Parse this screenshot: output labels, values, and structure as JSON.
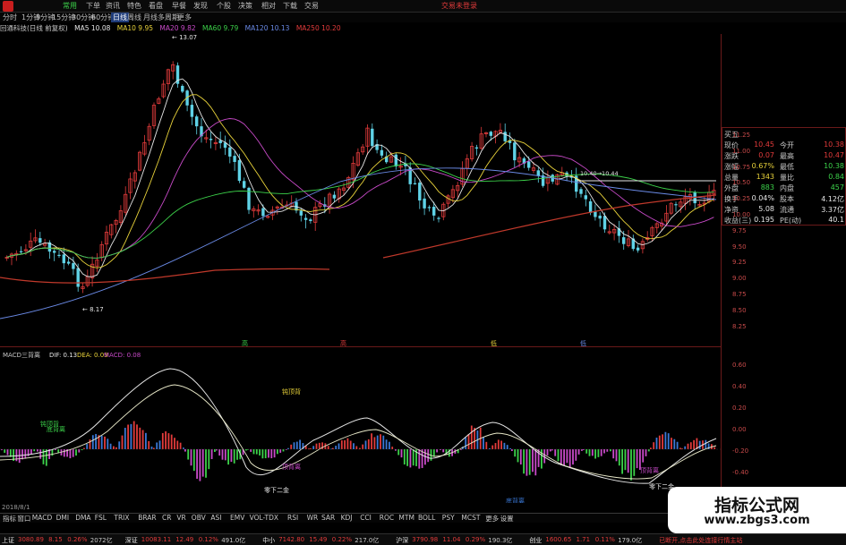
{
  "menubar": {
    "items": [
      "常用",
      "下单",
      "资讯",
      "特色",
      "看盘",
      "早餐",
      "发现",
      "个股",
      "决策",
      "相对",
      "下载",
      "交易"
    ],
    "notice": "交易未登录"
  },
  "periodbar": {
    "items": [
      "分时",
      "1分钟",
      "5分钟",
      "15分钟",
      "30分钟",
      "60分钟",
      "日线",
      "周线",
      "月线",
      "多周期",
      "更多"
    ]
  },
  "maline": {
    "stock": "回通科技(日线 前复权)",
    "ma5": "MA5 10.08",
    "ma10": "MA10 9.95",
    "ma20": "MA20 9.82",
    "ma60": "MA60 9.79",
    "ma120": "MA120 10.13",
    "ma250": "MA250 10.20"
  },
  "main_chart": {
    "price_axis": [
      "11.25",
      "11.00",
      "10.75",
      "10.50",
      "10.25",
      "10.00",
      "9.75",
      "9.50",
      "9.25",
      "9.00",
      "8.75",
      "8.50",
      "8.25"
    ],
    "high_label": "13.07",
    "low_label": "8.17",
    "mid_label": "10.40→10.44",
    "signal_labels": [
      "高",
      "高",
      "低",
      "低"
    ]
  },
  "macd": {
    "title": "MACD三背离",
    "dif": "DIF: 0.13",
    "dea": "DEA: 0.09",
    "macd": "MACD: 0.08",
    "axis": [
      "0.60",
      "0.40",
      "0.20",
      "0.00",
      "-0.20",
      "-0.40"
    ],
    "annotations": [
      "钝顶背",
      "顶背离",
      "底背离",
      "零下二金",
      "底背离",
      "零下二金",
      "顶背离",
      "钝顶背"
    ]
  },
  "quote_panel": {
    "rows": [
      {
        "k": "买五",
        "v": "",
        "k2": "",
        "v2": ""
      },
      {
        "k": "现价",
        "v": "10.45",
        "k2": "今开",
        "v2": "10.38"
      },
      {
        "k": "涨跌",
        "v": "0.07",
        "k2": "最高",
        "v2": "10.47"
      },
      {
        "k": "涨幅",
        "v": "0.67%",
        "k2": "最低",
        "v2": "10.38"
      },
      {
        "k": "总量",
        "v": "1343",
        "k2": "量比",
        "v2": "0.84"
      },
      {
        "k": "外盘",
        "v": "883",
        "k2": "内盘",
        "v2": "457"
      },
      {
        "k": "换手",
        "v": "0.04%",
        "k2": "股本",
        "v2": "4.12亿"
      },
      {
        "k": "净资",
        "v": "5.08",
        "k2": "流通",
        "v2": "3.37亿"
      },
      {
        "k": "收益(三)",
        "v": "0.195",
        "k2": "PE(动)",
        "v2": "40.1"
      }
    ]
  },
  "datestrip": {
    "label": "2018/8/1"
  },
  "tabbar": {
    "items": [
      "指标",
      "窗口",
      "MACD",
      "DMI",
      "DMA",
      "FSL",
      "TRIX",
      "BRAR",
      "CR",
      "VR",
      "OBV",
      "ASI",
      "EMV",
      "VOL-TDX",
      "RSI",
      "WR",
      "SAR",
      "KDJ",
      "CCI",
      "ROC",
      "MTM",
      "BOLL",
      "PSY",
      "MCST",
      "更多",
      "设置"
    ]
  },
  "statusbar": {
    "items": [
      {
        "t": "上证",
        "c": "#e6e6e6"
      },
      {
        "t": "3080.89",
        "c": "#e23b3b"
      },
      {
        "t": "8.15",
        "c": "#e23b3b"
      },
      {
        "t": "0.26%",
        "c": "#e23b3b"
      },
      {
        "t": "2072亿",
        "c": "#c8c8c8"
      },
      {
        "t": "深证",
        "c": "#e6e6e6"
      },
      {
        "t": "10083.11",
        "c": "#e23b3b"
      },
      {
        "t": "12.49",
        "c": "#e23b3b"
      },
      {
        "t": "0.12%",
        "c": "#e23b3b"
      },
      {
        "t": "491.0亿",
        "c": "#c8c8c8"
      },
      {
        "t": "中小",
        "c": "#e6e6e6"
      },
      {
        "t": "7142.80",
        "c": "#e23b3b"
      },
      {
        "t": "15.49",
        "c": "#e23b3b"
      },
      {
        "t": "0.22%",
        "c": "#e23b3b"
      },
      {
        "t": "217.0亿",
        "c": "#c8c8c8"
      },
      {
        "t": "沪深",
        "c": "#e6e6e6"
      },
      {
        "t": "3790.98",
        "c": "#e23b3b"
      },
      {
        "t": "11.04",
        "c": "#e23b3b"
      },
      {
        "t": "0.29%",
        "c": "#e23b3b"
      },
      {
        "t": "190.3亿",
        "c": "#c8c8c8"
      },
      {
        "t": "创业",
        "c": "#e6e6e6"
      },
      {
        "t": "1600.65",
        "c": "#e23b3b"
      },
      {
        "t": "1.71",
        "c": "#e23b3b"
      },
      {
        "t": "0.11%",
        "c": "#e23b3b"
      },
      {
        "t": "179.0亿",
        "c": "#c8c8c8"
      },
      {
        "t": "已断开,点击此处连接行情主站",
        "c": "#e23b3b"
      }
    ]
  },
  "watermark": {
    "line1": "指标公式网",
    "line2": "www.zbgs3.com"
  }
}
